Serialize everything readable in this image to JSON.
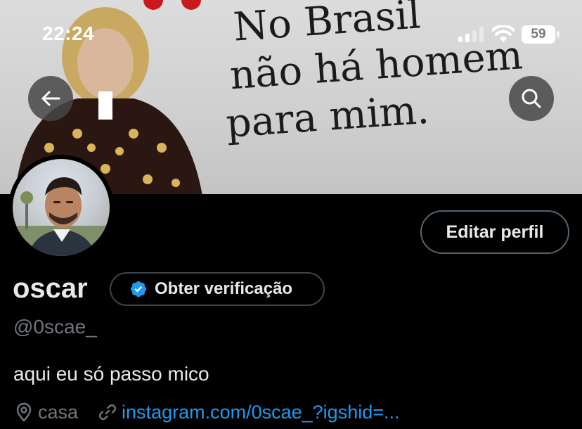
{
  "status_bar": {
    "time": "22:24",
    "battery": "59"
  },
  "banner": {
    "quote_lines": [
      "No Brasil",
      "não há homem",
      "para mim."
    ]
  },
  "profile": {
    "edit_label": "Editar perfil",
    "name": "oscar",
    "verification_label": "Obter verificação",
    "handle": "@0scae_",
    "bio": "aqui eu só passo mico",
    "location": "casa",
    "link": "instagram.com/0scae_?igshid=..."
  },
  "colors": {
    "background": "#000000",
    "text": "#e7e9ea",
    "muted": "#71767b",
    "accent": "#1d9bf0",
    "border": "#536471"
  },
  "icons": {
    "back": "arrow-left-icon",
    "search": "search-icon",
    "verified": "verified-badge-icon",
    "location": "location-pin-icon",
    "link": "link-icon"
  }
}
